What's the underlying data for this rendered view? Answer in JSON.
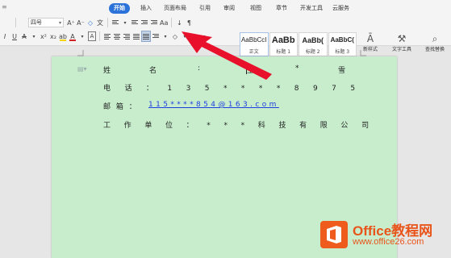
{
  "menu_tabs": [
    {
      "label": "开始",
      "active": true
    },
    {
      "label": "插入"
    },
    {
      "label": "页面布局"
    },
    {
      "label": "引用"
    },
    {
      "label": "审阅"
    },
    {
      "label": "视图"
    },
    {
      "label": "章节"
    },
    {
      "label": "开发工具"
    },
    {
      "label": "云服务"
    }
  ],
  "toolbar": {
    "font_size": "四号",
    "font_size_up": "A⁺",
    "font_size_down": "A⁻",
    "clear_format": "◇",
    "phonetic": "文",
    "bold_label": "I",
    "underline_label": "U",
    "strike_label": "A",
    "superscript_label": "x²",
    "subscript_label": "x₂",
    "highlight_label": "ab",
    "font_color_label": "A",
    "char_border_label": "A",
    "char_shading_label": "A",
    "case_label": "Aa",
    "sort_label": "↓",
    "show_marks_label": "¶",
    "highlight_color": "#f5d400",
    "font_color": "#d32020",
    "new_style_label": "新样式",
    "text_tools_label": "文字工具",
    "find_replace_label": "查找替换"
  },
  "styles": [
    {
      "preview": "AaBbCcI",
      "name": "正文",
      "selected": true
    },
    {
      "preview": "AaBb",
      "name": "标题 1"
    },
    {
      "preview": "AaBb(",
      "name": "标题 2"
    },
    {
      "preview": "AaBbC(",
      "name": "标题 3"
    }
  ],
  "document": {
    "line1": {
      "label": "姓",
      "label2": "名",
      "colon": ":",
      "v1": "王",
      "v2": "*",
      "v3": "雪"
    },
    "line2": {
      "text": "电 话 ： 1 3 5 * * * * 8 9 7 5"
    },
    "line3": {
      "label": "邮 箱 ：",
      "email": "115****854@163.com"
    },
    "line4": {
      "text": "工 作 单 位 ： * * * 科 技 有 限 公 司"
    }
  },
  "logo": {
    "title": "Office教程网",
    "url": "www.office26.com",
    "brand_color": "#e9541a"
  },
  "colors": {
    "accent": "#2b73d9",
    "arrow": "#e8102a",
    "page_bg": "#c7edcc",
    "link": "#1e3fe0"
  }
}
